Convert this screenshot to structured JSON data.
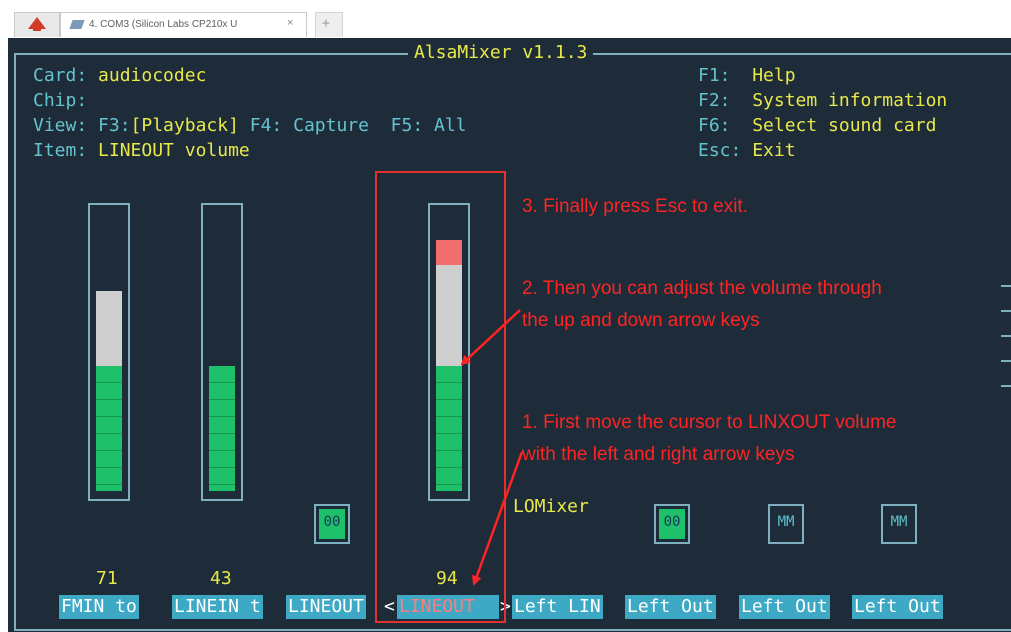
{
  "tabs": {
    "session_tab": "4. COM3 (Silicon Labs CP210x U",
    "close_glyph": "×",
    "new_tab_glyph": "+"
  },
  "mixer": {
    "title": "AlsaMixer v1.1.3",
    "info_left": [
      {
        "label": "Card: ",
        "value": "audiocodec"
      },
      {
        "label": "Chip: ",
        "value": ""
      },
      {
        "label": "View: F3:",
        "value": "[Playback]",
        "rest": " F4: Capture  F5: All"
      },
      {
        "label": "Item: ",
        "value": "LINEOUT volume"
      }
    ],
    "info_right": [
      {
        "key": "F1:  ",
        "text": "Help"
      },
      {
        "key": "F2:  ",
        "text": "System information"
      },
      {
        "key": "F6:  ",
        "text": "Select sound card"
      },
      {
        "key": "Esc: ",
        "text": "Exit"
      }
    ],
    "channels": [
      {
        "label": "FMIN to",
        "level": 71,
        "level_text": "71"
      },
      {
        "label": "LINEIN t",
        "level": 43,
        "level_text": "43"
      },
      {
        "label": "LINEOUT",
        "switch": "00"
      },
      {
        "label": "LINEOUT",
        "level": 94,
        "level_text": "94",
        "selected": true
      },
      {
        "label": "Left LIN"
      },
      {
        "label": "Left Out",
        "switch": "00"
      },
      {
        "label": "Left Out",
        "switch": "MM"
      },
      {
        "label": "Left Out",
        "switch": "MM"
      }
    ],
    "select_left": "<",
    "select_right": ">",
    "lomixer_label": "LOMixer"
  },
  "annotations": {
    "step3": "3. Finally press Esc to exit.",
    "step2_line1": "2. Then you can adjust the volume through",
    "step2_line2": "the up and down arrow keys",
    "step1_line1": "1. First move the cursor to LINXOUT volume",
    "step1_line2": "with the left and right arrow keys"
  },
  "colors": {
    "terminal_bg": "#1d2c38",
    "label": "#64c3cf",
    "value": "#e8e84a",
    "annotation": "#ff2424",
    "bar_green": "#1fc06a"
  }
}
